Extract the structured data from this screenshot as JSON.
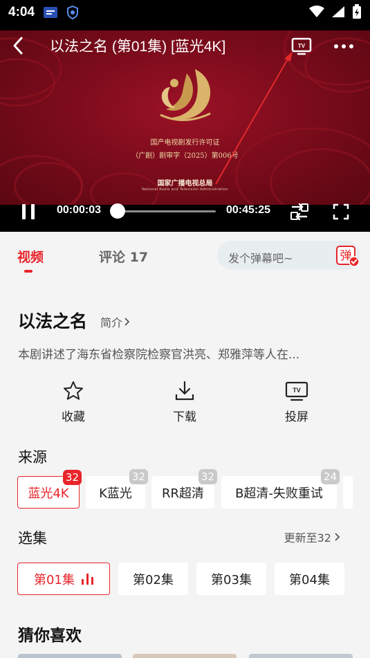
{
  "status_bar": {
    "time": "4:04"
  },
  "player": {
    "title": "以法之名 (第01集) [蓝光4K]",
    "current_time": "00:00:03",
    "duration": "00:45:25",
    "progress_fraction": 0.001,
    "frame": {
      "license_line1": "国产电视剧发行许可证",
      "license_line2": "（广剧）剧审字（2025）第006号",
      "org_name": "国家广播电视总局",
      "org_name_en": "National Radio and Television Administration"
    }
  },
  "tabs": [
    {
      "label": "视频",
      "active": true
    },
    {
      "label": "评论 17",
      "active": false
    }
  ],
  "danmu": {
    "placeholder": "发个弹幕吧~",
    "button_label": "弹"
  },
  "show": {
    "title": "以法之名",
    "intro_link": "简介",
    "description": "本剧讲述了海东省检察院检察官洪亮、郑雅萍等人在..."
  },
  "actions": [
    {
      "label": "收藏",
      "icon": "star-icon"
    },
    {
      "label": "下载",
      "icon": "download-icon"
    },
    {
      "label": "投屏",
      "icon": "tv-cast-icon"
    }
  ],
  "sources": {
    "title": "来源",
    "items": [
      {
        "label": "蓝光4K",
        "count": "32",
        "active": true
      },
      {
        "label": "K蓝光",
        "count": "32",
        "active": false
      },
      {
        "label": "RR超清",
        "count": "32",
        "active": false
      },
      {
        "label": "B超清-失败重试",
        "count": "24",
        "active": false
      }
    ]
  },
  "episodes": {
    "title": "选集",
    "update_text": "更新至32",
    "items": [
      {
        "label": "第01集",
        "active": true
      },
      {
        "label": "第02集",
        "active": false
      },
      {
        "label": "第03集",
        "active": false
      },
      {
        "label": "第04集",
        "active": false
      }
    ]
  },
  "recommend": {
    "title": "猜你喜欢"
  },
  "colors": {
    "accent": "#e8242a",
    "frame_red": "#7c0c1c",
    "gold": "#d9b46a"
  }
}
